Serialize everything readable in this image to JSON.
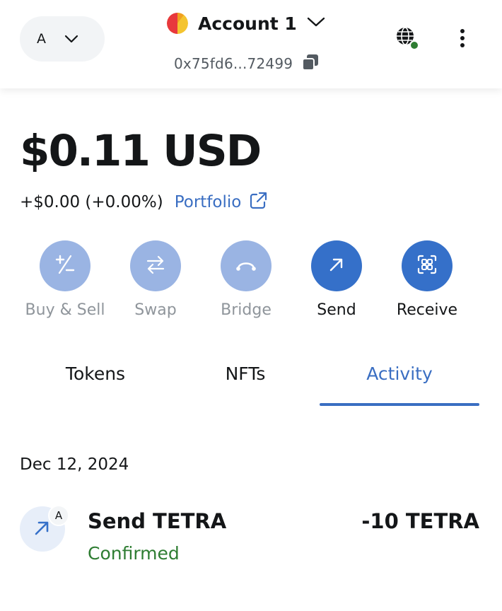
{
  "header": {
    "network_letter": "A",
    "account_name": "Account 1",
    "address": "0x75fd6...72499",
    "icons": {
      "network_chevron": "chevron-down-icon",
      "account_chevron": "chevron-down-icon",
      "copy": "copy-icon",
      "globe": "globe-icon",
      "more": "more-vertical-icon"
    },
    "connection_status_color": "#2e7d32"
  },
  "balance": {
    "amount": "$0.11 USD",
    "change": "+$0.00 (+0.00%)",
    "portfolio_label": "Portfolio",
    "portfolio_icon": "external-link-icon"
  },
  "actions": [
    {
      "label": "Buy & Sell",
      "icon": "plus-minus-icon",
      "enabled": false
    },
    {
      "label": "Swap",
      "icon": "swap-arrows-icon",
      "enabled": false
    },
    {
      "label": "Bridge",
      "icon": "bridge-icon",
      "enabled": false
    },
    {
      "label": "Send",
      "icon": "arrow-up-right-icon",
      "enabled": true
    },
    {
      "label": "Receive",
      "icon": "qr-code-icon",
      "enabled": true
    }
  ],
  "tabs": [
    {
      "label": "Tokens",
      "active": false
    },
    {
      "label": "NFTs",
      "active": false
    },
    {
      "label": "Activity",
      "active": true
    }
  ],
  "activity": {
    "groups": [
      {
        "date": "Dec 12, 2024",
        "items": [
          {
            "title": "Send TETRA",
            "status": "Confirmed",
            "amount": "-10 TETRA",
            "badge": "A",
            "icon": "arrow-up-right-icon"
          }
        ]
      }
    ]
  },
  "colors": {
    "accent": "#3a6ec2",
    "button_active": "#3570c9",
    "button_disabled": "#9ab4e3",
    "status_confirmed": "#2e7d32"
  }
}
